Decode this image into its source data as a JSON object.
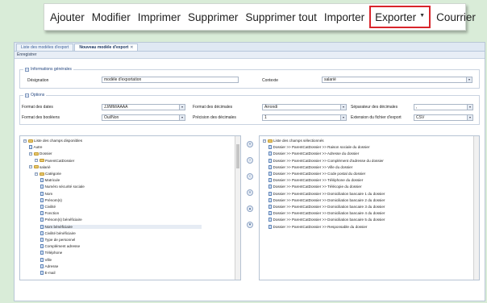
{
  "toolbar": {
    "add": "Ajouter",
    "modify": "Modifier",
    "print": "Imprimer",
    "delete": "Supprimer",
    "delete_all": "Supprimer tout",
    "import": "Importer",
    "export": "Exporter",
    "mail": "Courrier",
    "export_highlight_color": "#d8252b"
  },
  "tabs": [
    {
      "label": "Liste des modèles d'export"
    },
    {
      "label": "Nouveau modèle d'export"
    }
  ],
  "subbar": {
    "save": "Enregistrer"
  },
  "general": {
    "legend": "Informations générales",
    "designation_label": "Désignation",
    "designation_value": "modèle d'exportation",
    "context_label": "Contexte",
    "context_value": "salarié"
  },
  "options": {
    "legend": "Options",
    "date_format_label": "Format des dates",
    "date_format_value": "JJ/MM/AAAA",
    "decimal_format_label": "Format des décimales",
    "decimal_format_value": "Arrondi",
    "decimal_separator_label": "Séparateur des décimales",
    "decimal_separator_value": ",",
    "bool_format_label": "Format des booléens",
    "bool_format_value": "Oui/Non",
    "decimal_precision_label": "Précision des décimales",
    "decimal_precision_value": "1",
    "file_ext_label": "Extension du fichier d'export",
    "file_ext_value": "CSV"
  },
  "available_tree": [
    {
      "label": "Liste des champs disponibles",
      "type": "fold"
    },
    {
      "label": "Autre",
      "type": "leaf"
    },
    {
      "label": "Dossier",
      "type": "fold"
    },
    {
      "label": "ParentCatDossier",
      "type": "fold"
    },
    {
      "label": "salarié",
      "type": "fold"
    },
    {
      "label": "Catégorie",
      "type": "fold"
    },
    {
      "label": "Matricule",
      "type": "leaf"
    },
    {
      "label": "Numéro sécurité sociale",
      "type": "leaf"
    },
    {
      "label": "Nom",
      "type": "leaf"
    },
    {
      "label": "Prénom(s)",
      "type": "leaf"
    },
    {
      "label": "Civilité",
      "type": "leaf"
    },
    {
      "label": "Fonction",
      "type": "leaf"
    },
    {
      "label": "Prénom(s) bénéficiaire",
      "type": "leaf"
    },
    {
      "label": "Nom bénéficiaire",
      "type": "leaf"
    },
    {
      "label": "Civilité bénéficiaire",
      "type": "leaf"
    },
    {
      "label": "Type de personnel",
      "type": "leaf"
    },
    {
      "label": "Complément adresse",
      "type": "leaf"
    },
    {
      "label": "Téléphone",
      "type": "leaf"
    },
    {
      "label": "Ville",
      "type": "leaf"
    },
    {
      "label": "Adresse",
      "type": "leaf"
    },
    {
      "label": "E-mail",
      "type": "leaf"
    }
  ],
  "selected_tree": [
    {
      "label": "Liste des champs sélectionnés",
      "type": "fold"
    },
    {
      "label": "Dossier >> ParentCatDossier >> Raison sociale du dossier",
      "type": "leaf"
    },
    {
      "label": "Dossier >> ParentCatDossier >> Adresse du dossier",
      "type": "leaf"
    },
    {
      "label": "Dossier >> ParentCatDossier >> Complément d'adresse du dossier",
      "type": "leaf"
    },
    {
      "label": "Dossier >> ParentCatDossier >> Ville du dossier",
      "type": "leaf"
    },
    {
      "label": "Dossier >> ParentCatDossier >> Code postal du dossier",
      "type": "leaf"
    },
    {
      "label": "Dossier >> ParentCatDossier >> Téléphone du dossier",
      "type": "leaf"
    },
    {
      "label": "Dossier >> ParentCatDossier >> Télécopie du dossier",
      "type": "leaf"
    },
    {
      "label": "Dossier >> ParentCatDossier >> Domiciliation bancaire 1 du dossier",
      "type": "leaf"
    },
    {
      "label": "Dossier >> ParentCatDossier >> Domiciliation bancaire 2 du dossier",
      "type": "leaf"
    },
    {
      "label": "Dossier >> ParentCatDossier >> Domiciliation bancaire 3 du dossier",
      "type": "leaf"
    },
    {
      "label": "Dossier >> ParentCatDossier >> Domiciliation bancaire 4 du dossier",
      "type": "leaf"
    },
    {
      "label": "Dossier >> ParentCatDossier >> Domiciliation bancaire 5 du dossier",
      "type": "leaf"
    },
    {
      "label": "Dossier >> ParentCatDossier >> Responsable du dossier",
      "type": "leaf"
    }
  ],
  "transfer_buttons": [
    "»",
    "›",
    "‹",
    "«",
    "▴",
    "▾"
  ],
  "colors": {
    "background": "#d9ecd8",
    "panel_border": "#b6c3d3",
    "accent_blue": "#24467f"
  }
}
